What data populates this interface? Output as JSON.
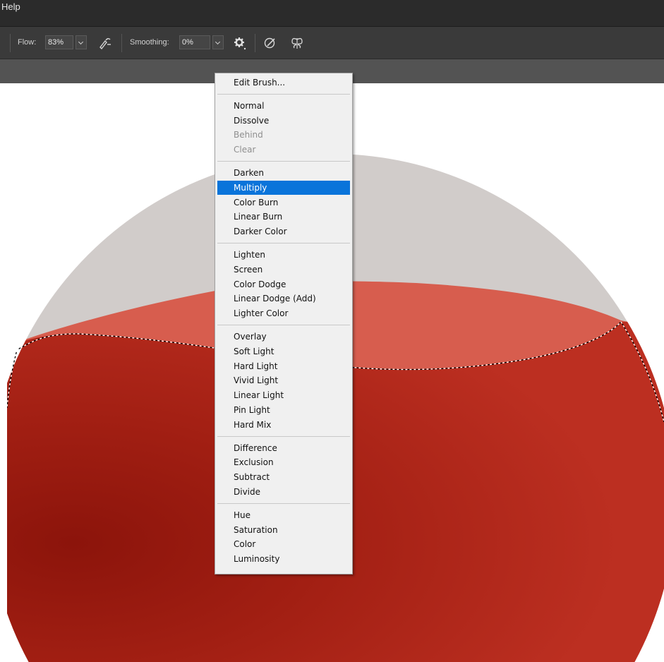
{
  "menubar": {
    "help_label": "Help"
  },
  "options_bar": {
    "flow_label": "Flow:",
    "flow_value": "83%",
    "smoothing_label": "Smoothing:",
    "smoothing_value": "0%",
    "icons": [
      "airbrush-icon",
      "gear-icon",
      "pressure-size-icon",
      "symmetry-icon"
    ]
  },
  "blend_menu": {
    "edit_brush": "Edit Brush...",
    "group_normal": [
      "Normal",
      "Dissolve",
      "Behind",
      "Clear"
    ],
    "disabled": [
      "Behind",
      "Clear"
    ],
    "group_darken": [
      "Darken",
      "Multiply",
      "Color Burn",
      "Linear Burn",
      "Darker Color"
    ],
    "selected": "Multiply",
    "group_lighten": [
      "Lighten",
      "Screen",
      "Color Dodge",
      "Linear Dodge (Add)",
      "Lighter Color"
    ],
    "group_contrast": [
      "Overlay",
      "Soft Light",
      "Hard Light",
      "Vivid Light",
      "Linear Light",
      "Pin Light",
      "Hard Mix"
    ],
    "group_inversion": [
      "Difference",
      "Exclusion",
      "Subtract",
      "Divide"
    ],
    "group_component": [
      "Hue",
      "Saturation",
      "Color",
      "Luminosity"
    ]
  },
  "colors": {
    "selection_highlight": "#0a74da",
    "sphere_top": "#d1ccca",
    "liquid_surface": "#d75d4e",
    "liquid_body": "#b92d1f",
    "liquid_shadow": "#8c140b"
  }
}
